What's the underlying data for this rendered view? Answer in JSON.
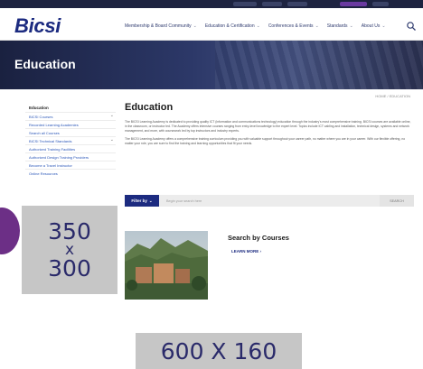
{
  "header": {
    "logo": "Bicsi",
    "nav": [
      "Membership & Board Community",
      "Education & Certification",
      "Conferences & Events",
      "Standards",
      "About Us"
    ]
  },
  "hero": {
    "title": "Education"
  },
  "breadcrumb": "HOME / EDUCATION",
  "sidebar": {
    "title": "Education",
    "items": [
      "BICSI Courses",
      "Recorded Learning Academies",
      "Search all Courses",
      "BICSI Technical Standards",
      "Authorized Training Facilities",
      "Authorized Design Training Providers",
      "Become a Travel Instructor",
      "Online Resources"
    ]
  },
  "main": {
    "title": "Education",
    "paragraphs": [
      "The BICSI Learning Academy is dedicated to providing quality ICT (information and communications technology) education through the industry's most comprehensive training. BICSI courses are available online, in the classroom, or instructor led. The Academy offers intensive courses ranging from entry-level knowledge to the expert level. Topics include ICT cabling and installation, technical design, systems and network management, and more, with coursework led by top instructors and industry experts.",
      "The BICSI Learning Academy offers a comprehensive training curriculum providing you with valuable support throughout your career path, no matter where you are in your career. With our flexible offering, no matter your role, you are sure to find the training and learning opportunities that fit your needs."
    ],
    "filter": {
      "button_label": "Filter by",
      "placeholder": "Begin your search here",
      "search_label": "SEARCH"
    },
    "courses": {
      "heading": "Search by Courses",
      "link": "LEARN MORE ›"
    }
  },
  "placeholders": {
    "box1": {
      "line1": "350",
      "line2": "x",
      "line3": "300"
    },
    "box2": "600 X 160"
  },
  "colors": {
    "brand": "#1c2b80",
    "hero_dark": "#1a2140",
    "placeholder": "#c6c6c6",
    "accent_purple": "#6c2f86"
  }
}
